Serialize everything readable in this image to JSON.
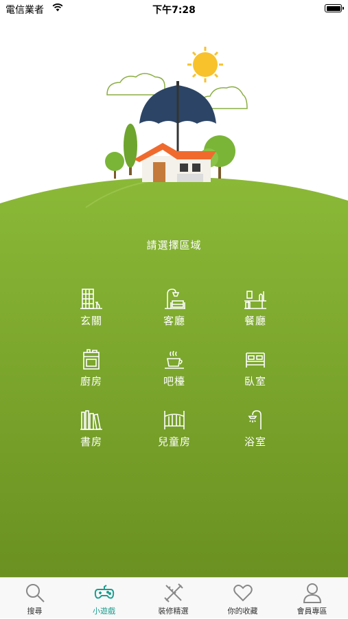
{
  "status": {
    "carrier": "電信業者",
    "time": "下午7:28"
  },
  "main": {
    "title": "請選擇區域"
  },
  "rooms": [
    {
      "label": "玄關",
      "icon": "entrance-icon"
    },
    {
      "label": "客廳",
      "icon": "living-room-lamp-sofa-icon"
    },
    {
      "label": "餐廳",
      "icon": "dining-table-icon"
    },
    {
      "label": "廚房",
      "icon": "stove-icon"
    },
    {
      "label": "吧檯",
      "icon": "coffee-cup-icon"
    },
    {
      "label": "臥室",
      "icon": "bed-icon"
    },
    {
      "label": "書房",
      "icon": "bookshelf-icon"
    },
    {
      "label": "兒童房",
      "icon": "crib-icon"
    },
    {
      "label": "浴室",
      "icon": "shower-icon"
    }
  ],
  "tabs": [
    {
      "label": "搜尋",
      "icon": "search-icon"
    },
    {
      "label": "小遊戲",
      "icon": "gamepad-icon",
      "active": true
    },
    {
      "label": "裝修精選",
      "icon": "pencil-ruler-icon"
    },
    {
      "label": "你的收藏",
      "icon": "heart-icon"
    },
    {
      "label": "會員專區",
      "icon": "user-icon"
    }
  ],
  "colors": {
    "hill_top": "#88b535",
    "hill_bottom": "#6c9322",
    "accent": "#1a9e8f",
    "umbrella": "#2c4566",
    "roof": "#f06a2e",
    "sun": "#f7c22c"
  }
}
